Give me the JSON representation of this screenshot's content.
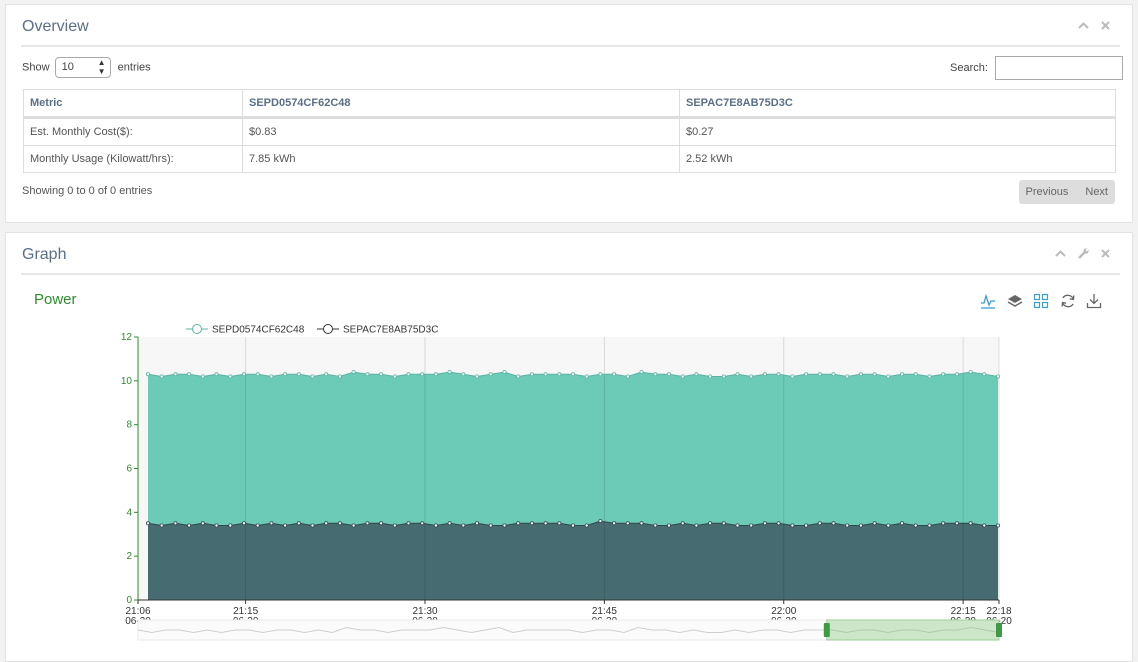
{
  "overview": {
    "title": "Overview",
    "show_label": "Show",
    "entries_value": "10",
    "entries_label": "entries",
    "search_label": "Search:",
    "search_value": "",
    "headers": [
      "Metric",
      "SEPD0574CF62C48",
      "SEPAC7E8AB75D3C"
    ],
    "rows": [
      [
        "Est. Monthly Cost($):",
        "$0.83",
        "$0.27"
      ],
      [
        "Monthly Usage (Kilowatt/hrs):",
        "7.85 kWh",
        "2.52 kWh"
      ]
    ],
    "info": "Showing 0 to 0 of 0 entries",
    "prev_label": "Previous",
    "next_label": "Next",
    "tool_icons": [
      "chevron-up-icon",
      "close-icon"
    ]
  },
  "graph": {
    "title": "Graph",
    "tool_icons": [
      "chevron-up-icon",
      "wrench-icon",
      "close-icon"
    ],
    "toolbox_icons": [
      "line-chart-icon",
      "stack-icon",
      "tiled-icon",
      "refresh-icon",
      "download-icon"
    ]
  },
  "chart_data": {
    "type": "area",
    "title": "Power",
    "stacked": false,
    "ylim": [
      0,
      12
    ],
    "yticks": [
      0,
      2,
      4,
      6,
      8,
      10,
      12
    ],
    "xlim": [
      "21:06",
      "22:18"
    ],
    "xticks": [
      {
        "time": "21:06",
        "date": "06-20"
      },
      {
        "time": "21:15",
        "date": "06-20"
      },
      {
        "time": "21:30",
        "date": "06-20"
      },
      {
        "time": "21:45",
        "date": "06-20"
      },
      {
        "time": "22:00",
        "date": "06-20"
      },
      {
        "time": "22:15",
        "date": "06-20"
      },
      {
        "time": "22:18",
        "date": "06-20"
      }
    ],
    "grid": true,
    "legend": "top-left",
    "series": [
      {
        "name": "SEPD0574CF62C48",
        "color": "#6ccbb6",
        "values": [
          10.3,
          10.2,
          10.3,
          10.3,
          10.2,
          10.3,
          10.2,
          10.3,
          10.3,
          10.2,
          10.3,
          10.3,
          10.2,
          10.3,
          10.2,
          10.4,
          10.3,
          10.3,
          10.2,
          10.3,
          10.3,
          10.3,
          10.4,
          10.3,
          10.2,
          10.3,
          10.4,
          10.2,
          10.3,
          10.3,
          10.3,
          10.3,
          10.2,
          10.3,
          10.3,
          10.2,
          10.4,
          10.3,
          10.3,
          10.2,
          10.3,
          10.2,
          10.2,
          10.3,
          10.2,
          10.3,
          10.3,
          10.2,
          10.3,
          10.3,
          10.3,
          10.2,
          10.3,
          10.3,
          10.2,
          10.3,
          10.3,
          10.2,
          10.3,
          10.3,
          10.4,
          10.3,
          10.2
        ]
      },
      {
        "name": "SEPAC7E8AB75D3C",
        "color": "#466b71",
        "values": [
          3.5,
          3.4,
          3.5,
          3.4,
          3.5,
          3.4,
          3.4,
          3.5,
          3.4,
          3.5,
          3.4,
          3.5,
          3.4,
          3.5,
          3.5,
          3.4,
          3.5,
          3.5,
          3.4,
          3.5,
          3.5,
          3.4,
          3.5,
          3.4,
          3.5,
          3.4,
          3.4,
          3.5,
          3.5,
          3.5,
          3.5,
          3.4,
          3.4,
          3.6,
          3.5,
          3.5,
          3.5,
          3.4,
          3.4,
          3.5,
          3.4,
          3.5,
          3.5,
          3.4,
          3.4,
          3.5,
          3.5,
          3.4,
          3.4,
          3.5,
          3.5,
          3.4,
          3.4,
          3.5,
          3.4,
          3.5,
          3.4,
          3.4,
          3.5,
          3.5,
          3.5,
          3.4,
          3.4
        ]
      }
    ],
    "zoom_range": [
      0.8,
      1.0
    ]
  }
}
